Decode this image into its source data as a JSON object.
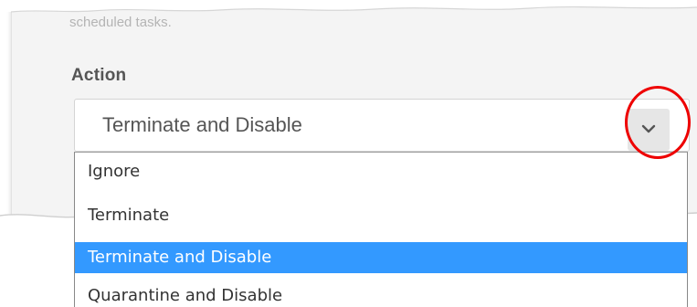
{
  "description_text": "scheduled tasks.",
  "action": {
    "label": "Action",
    "selected_value": "Terminate and Disable",
    "toggle_icon": "chevron-down-icon",
    "options": [
      {
        "label": "Ignore",
        "selected": false
      },
      {
        "label": "Terminate",
        "selected": false
      },
      {
        "label": "Terminate and Disable",
        "selected": true
      },
      {
        "label": "Quarantine and Disable",
        "selected": false
      }
    ]
  },
  "colors": {
    "selection_highlight": "#3399ff",
    "annotation_ring": "#ee0000",
    "label_text": "#555555",
    "panel_background": "#f4f4f4"
  }
}
